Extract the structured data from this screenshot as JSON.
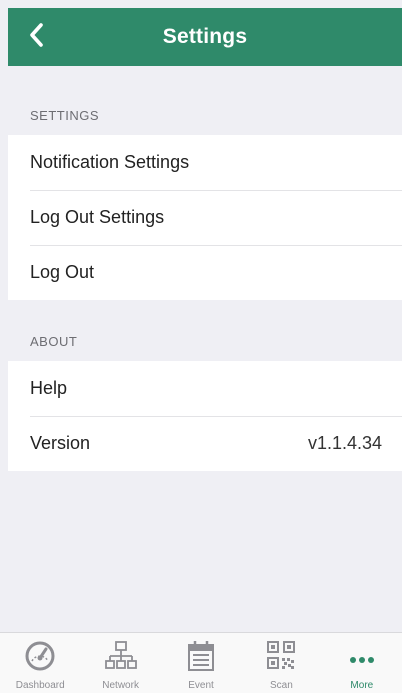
{
  "header": {
    "title": "Settings",
    "back_icon": "chevron-left-icon"
  },
  "colors": {
    "accent": "#2f8a6a",
    "background": "#efeff4",
    "inactive": "#8e8e93"
  },
  "sections": [
    {
      "header": "SETTINGS",
      "items": [
        {
          "label": "Notification Settings"
        },
        {
          "label": "Log Out Settings"
        },
        {
          "label": "Log Out"
        }
      ]
    },
    {
      "header": "ABOUT",
      "items": [
        {
          "label": "Help"
        },
        {
          "label": "Version",
          "value": "v1.1.4.34"
        }
      ]
    }
  ],
  "tabbar": {
    "items": [
      {
        "label": "Dashboard",
        "icon": "speedometer-icon",
        "active": false
      },
      {
        "label": "Network",
        "icon": "network-icon",
        "active": false
      },
      {
        "label": "Event",
        "icon": "calendar-icon",
        "active": false
      },
      {
        "label": "Scan",
        "icon": "qr-code-icon",
        "active": false
      },
      {
        "label": "More",
        "icon": "more-dots-icon",
        "active": true
      }
    ]
  }
}
